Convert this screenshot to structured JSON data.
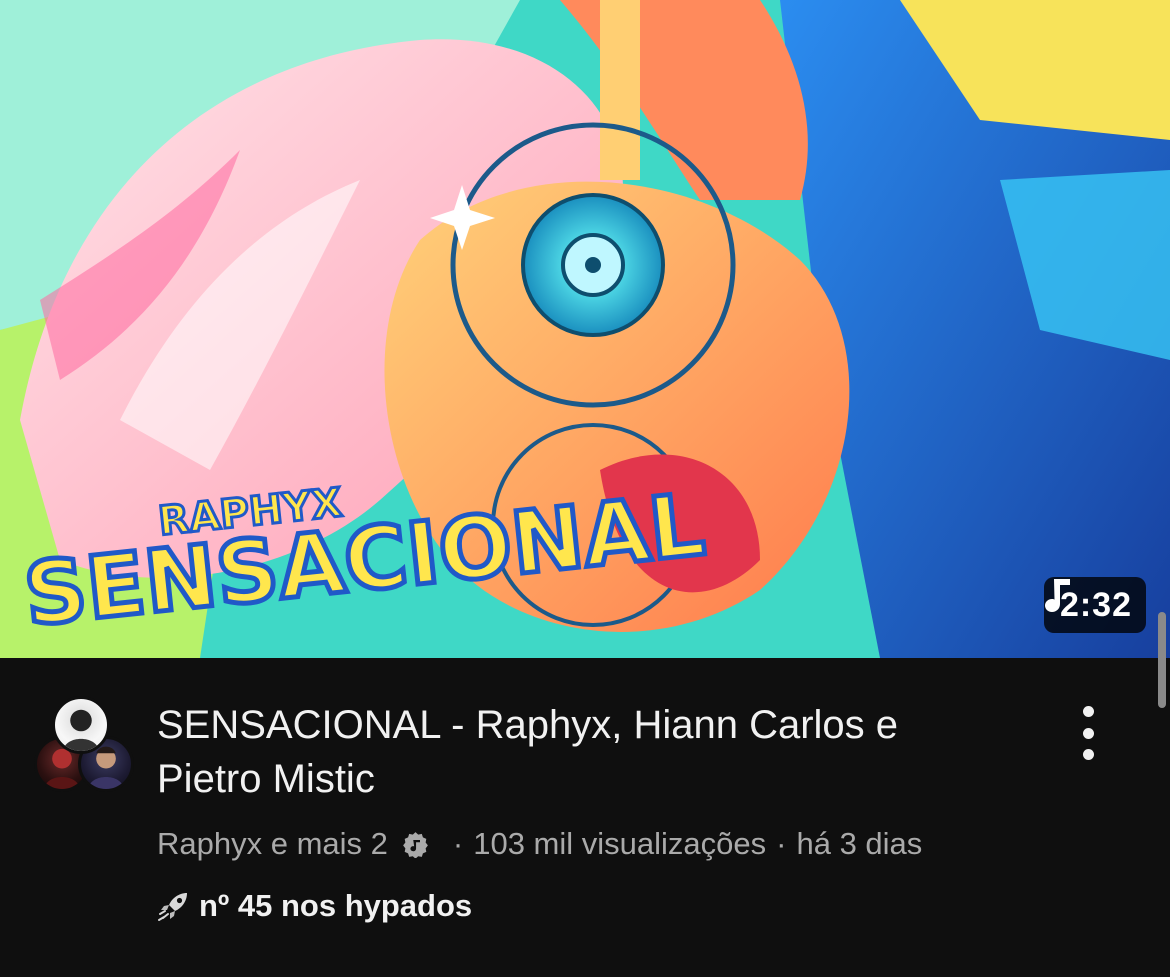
{
  "video": {
    "thumbnail_art_text": "RAPHYX SENSACIONAL",
    "duration": "2:32",
    "duration_icon": "music-note-icon",
    "title": "SENSACIONAL - Raphyx, Hiann Carlos e Pietro Mistic",
    "channel": "Raphyx e mais 2",
    "views": "103 mil visualizações",
    "age": "há 3 dias",
    "separator": "·",
    "hype": "nº 45 nos hypados",
    "hype_icon": "rocket-hype-icon",
    "menu_icon": "more-vertical-icon"
  },
  "colors": {
    "background": "#0f0f0f",
    "title": "#f1f1f1",
    "secondary_text": "#aaaaaa",
    "badge_bg": "#000000"
  }
}
